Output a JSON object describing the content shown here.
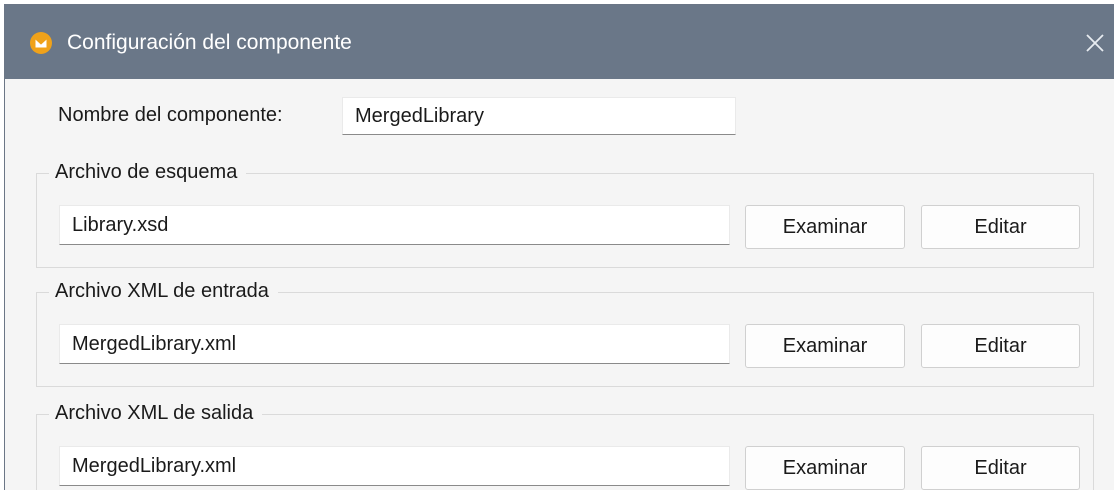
{
  "window": {
    "title": "Configuración del componente",
    "icon": "altova-app-icon",
    "close_icon": "close-icon"
  },
  "component_name": {
    "label": "Nombre del componente:",
    "value": "MergedLibrary"
  },
  "groups": [
    {
      "legend": "Archivo de esquema",
      "value": "Library.xsd",
      "browse_label": "Examinar",
      "edit_label": "Editar"
    },
    {
      "legend": "Archivo XML de entrada",
      "value": "MergedLibrary.xml",
      "browse_label": "Examinar",
      "edit_label": "Editar"
    },
    {
      "legend": "Archivo XML de salida",
      "value": "MergedLibrary.xml",
      "browse_label": "Examinar",
      "edit_label": "Editar"
    }
  ],
  "colors": {
    "titlebar": "#6a7788",
    "app_icon": "#f0a21a",
    "dialog_background": "#f5f5f5"
  }
}
